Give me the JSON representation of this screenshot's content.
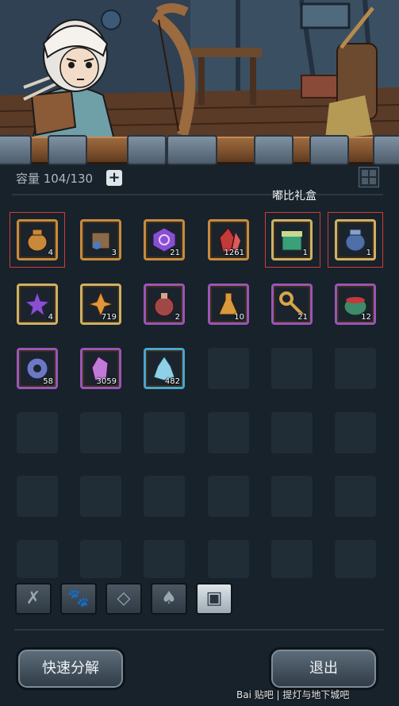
{
  "inventory": {
    "capacity_label": "容量 104/130",
    "add_label": "+",
    "gift_box_label": "嘟比礼盒",
    "items": [
      {
        "name": "amphora",
        "count": "4",
        "rarity": "rare-orange",
        "icon": "amphora-icon",
        "color": "#c9893a"
      },
      {
        "name": "scroll-bundle",
        "count": "3",
        "rarity": "rare-orange",
        "icon": "scroll-bundle-icon",
        "color": "#8a6a4a"
      },
      {
        "name": "purple-rune",
        "count": "21",
        "rarity": "rare-orange",
        "icon": "rune-icon",
        "color": "#8a4fd1"
      },
      {
        "name": "red-crystal",
        "count": "1261",
        "rarity": "rare-orange",
        "icon": "red-crystal-icon",
        "color": "#c23a3a"
      },
      {
        "name": "dubi-gift-box",
        "count": "1",
        "rarity": "rare-gold",
        "icon": "gift-box-icon",
        "color": "#3aa07a"
      },
      {
        "name": "blue-jar",
        "count": "1",
        "rarity": "rare-gold",
        "icon": "jar-icon",
        "color": "#4f6fa8"
      },
      {
        "name": "star-shard",
        "count": "4",
        "rarity": "rare-gold",
        "icon": "star-shard-icon",
        "color": "#8a4fd1"
      },
      {
        "name": "gold-crystal",
        "count": "719",
        "rarity": "rare-gold",
        "icon": "gold-crystal-icon",
        "color": "#e0963a"
      },
      {
        "name": "paw-potion",
        "count": "2",
        "rarity": "rare-purple",
        "icon": "paw-potion-icon",
        "color": "#a04848"
      },
      {
        "name": "gold-flask",
        "count": "10",
        "rarity": "rare-purple",
        "icon": "flask-icon",
        "color": "#d89a3a"
      },
      {
        "name": "key",
        "count": "21",
        "rarity": "rare-purple",
        "icon": "key-icon",
        "color": "#d6a54a"
      },
      {
        "name": "cauldron",
        "count": "12",
        "rarity": "rare-purple",
        "icon": "cauldron-icon",
        "color": "#3f8a6a"
      },
      {
        "name": "gear-stone",
        "count": "58",
        "rarity": "rare-purple",
        "icon": "gear-stone-icon",
        "color": "#6c79c2"
      },
      {
        "name": "pink-crystal",
        "count": "3059",
        "rarity": "rare-purple",
        "icon": "pink-crystal-icon",
        "color": "#c27ad8"
      },
      {
        "name": "ice-crystal",
        "count": "482",
        "rarity": "rare-blue",
        "icon": "ice-crystal-icon",
        "color": "#8fd0e8"
      }
    ]
  },
  "tabs": [
    {
      "name": "tab-tools",
      "glyph": "✗"
    },
    {
      "name": "tab-pets",
      "glyph": "🐾"
    },
    {
      "name": "tab-gems",
      "glyph": "◇"
    },
    {
      "name": "tab-materials",
      "glyph": "♠"
    },
    {
      "name": "tab-chests",
      "glyph": "▣"
    }
  ],
  "buttons": {
    "quick_dismantle": "快速分解",
    "exit": "退出"
  },
  "watermark": "Bai 贴吧 | 提灯与地下城吧"
}
